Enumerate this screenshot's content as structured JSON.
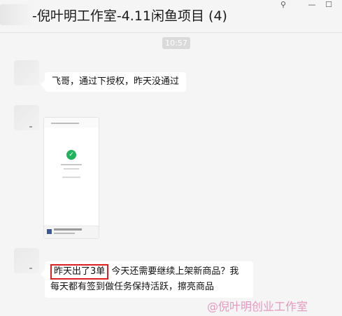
{
  "window": {
    "title": "-倪叶明工作室-4.11闲鱼项目 (4)",
    "controls": {
      "pin_icon": "⚲",
      "minimize_icon": "—",
      "maximize_icon": "☐"
    }
  },
  "chat": {
    "timestamp": "10:57",
    "messages": [
      {
        "type": "text",
        "text": "飞哥，通过下授权，昨天没通过"
      },
      {
        "type": "image",
        "description_icon": "phone-screenshot"
      },
      {
        "type": "text",
        "highlight": "昨天出了3单",
        "text": " 今天还需要继续上架新商品？我每天都有签到做任务保持活跃，擦亮商品"
      }
    ]
  },
  "watermark": "@倪叶明创业工作室",
  "colors": {
    "highlight_border": "#e02020",
    "success_green": "#21b35b"
  }
}
